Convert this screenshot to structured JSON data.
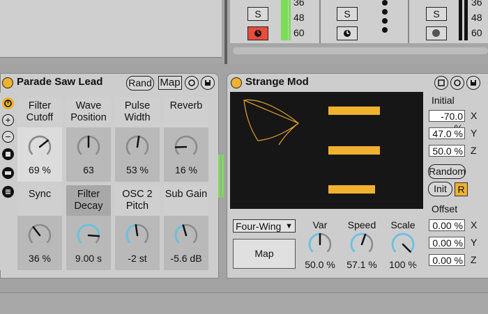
{
  "mixer": {
    "s_label": "S",
    "meter_scale": [
      "36",
      "48",
      "60"
    ],
    "meter_scale_right": [
      "36",
      "48",
      "60"
    ]
  },
  "instrument": {
    "title": "Parade Saw Lead",
    "rand_label": "Rand",
    "map_label": "Map",
    "macros": [
      {
        "label": "Filter\nCutoff",
        "value": "69 %",
        "level": 0.69
      },
      {
        "label": "Wave\nPosition",
        "value": "63",
        "level": 0.5
      },
      {
        "label": "Pulse\nWidth",
        "value": "53 %",
        "level": 0.53
      },
      {
        "label": "Reverb",
        "value": "16 %",
        "level": 0.16
      },
      {
        "label": "Sync",
        "value": "36 %",
        "level": 0.36
      },
      {
        "label": "Filter\nDecay",
        "value": "9.00 s",
        "level": 0.85
      },
      {
        "label": "OSC 2\nPitch",
        "value": "-2 st",
        "level": 0.47
      },
      {
        "label": "Sub Gain",
        "value": "-5.6 dB",
        "level": 0.44
      }
    ],
    "side_plus": "+",
    "side_minus": "−"
  },
  "mod": {
    "title": "Strange Mod",
    "bar_levels": [
      0.97,
      0.98,
      0.88
    ],
    "initial_label": "Initial",
    "initial": [
      {
        "axis": "X",
        "value": "-70.0 %"
      },
      {
        "axis": "Y",
        "value": "47.0 %"
      },
      {
        "axis": "Z",
        "value": "50.0 %"
      }
    ],
    "random_label": "Random",
    "init_label": "Init",
    "r_label": "R",
    "offset_label": "Offset",
    "offset": [
      {
        "axis": "X",
        "value": "0.00 %"
      },
      {
        "axis": "Y",
        "value": "0.00 %"
      },
      {
        "axis": "Z",
        "value": "0.00 %"
      }
    ],
    "attractor": "Four-Wing",
    "map_label": "Map",
    "knobs": [
      {
        "label": "Var",
        "value": "50.0 %",
        "level": 0.5
      },
      {
        "label": "Speed",
        "value": "57.1 %",
        "level": 0.571
      },
      {
        "label": "Scale",
        "value": "100 %",
        "level": 1.0
      }
    ]
  },
  "colors": {
    "accent_orange": "#f0b030",
    "knob_blue": "#62c4e8",
    "meter_green": "#7bdc57",
    "record_red": "#ea4c3c"
  }
}
